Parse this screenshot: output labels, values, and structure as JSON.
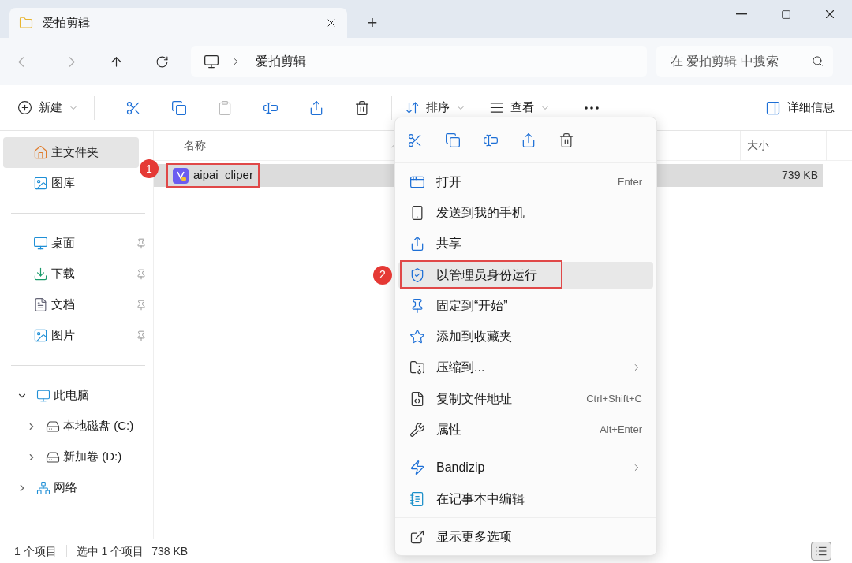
{
  "window": {
    "tab_title": "爱拍剪辑",
    "new_tab": "+"
  },
  "address": {
    "path": "爱拍剪辑",
    "search_placeholder": "在 爱拍剪辑 中搜索"
  },
  "toolbar": {
    "new": "新建",
    "sort": "排序",
    "view": "查看",
    "details": "详细信息"
  },
  "sidebar": {
    "quick": [
      {
        "label": "主文件夹",
        "selected": true
      },
      {
        "label": "图库",
        "selected": false
      }
    ],
    "pinned": [
      {
        "label": "桌面",
        "pinned": true
      },
      {
        "label": "下载",
        "pinned": true
      },
      {
        "label": "文档",
        "pinned": true
      },
      {
        "label": "图片",
        "pinned": true
      }
    ],
    "tree": [
      {
        "label": "此电脑",
        "expanded": true,
        "children": [
          {
            "label": "本地磁盘 (C:)",
            "expanded": false
          },
          {
            "label": "新加卷 (D:)",
            "expanded": false
          }
        ]
      },
      {
        "label": "网络",
        "expanded": false
      }
    ]
  },
  "table": {
    "columns": [
      "名称",
      "大小"
    ],
    "rows": [
      {
        "name": "aipai_cliper",
        "size": "739 KB",
        "selected": true,
        "annotated": true,
        "badge": "1"
      }
    ]
  },
  "context_menu": {
    "groups": [
      [
        {
          "label": "打开",
          "shortcut": "Enter",
          "submenu": false,
          "highlighted": false,
          "annotated": false
        },
        {
          "label": "发送到我的手机",
          "submenu": false,
          "highlighted": false,
          "annotated": false
        },
        {
          "label": "共享",
          "submenu": false,
          "highlighted": false,
          "annotated": false
        },
        {
          "label": "以管理员身份运行",
          "submenu": false,
          "highlighted": true,
          "annotated": true,
          "badge": "2"
        },
        {
          "label": "固定到“开始”",
          "submenu": false,
          "highlighted": false,
          "annotated": false
        },
        {
          "label": "添加到收藏夹",
          "submenu": false,
          "highlighted": false,
          "annotated": false
        },
        {
          "label": "压缩到...",
          "submenu": true,
          "highlighted": false,
          "annotated": false
        },
        {
          "label": "复制文件地址",
          "shortcut": "Ctrl+Shift+C",
          "submenu": false,
          "highlighted": false,
          "annotated": false
        },
        {
          "label": "属性",
          "shortcut": "Alt+Enter",
          "submenu": false,
          "highlighted": false,
          "annotated": false
        }
      ],
      [
        {
          "label": "Bandizip",
          "submenu": true,
          "highlighted": false,
          "annotated": false
        },
        {
          "label": "在记事本中编辑",
          "submenu": false,
          "highlighted": false,
          "annotated": false
        }
      ],
      [
        {
          "label": "显示更多选项",
          "submenu": false,
          "highlighted": false,
          "annotated": false
        }
      ]
    ]
  },
  "status_bar": {
    "count": "1 个项目",
    "selection": "选中 1 个项目",
    "size": "738 KB"
  }
}
